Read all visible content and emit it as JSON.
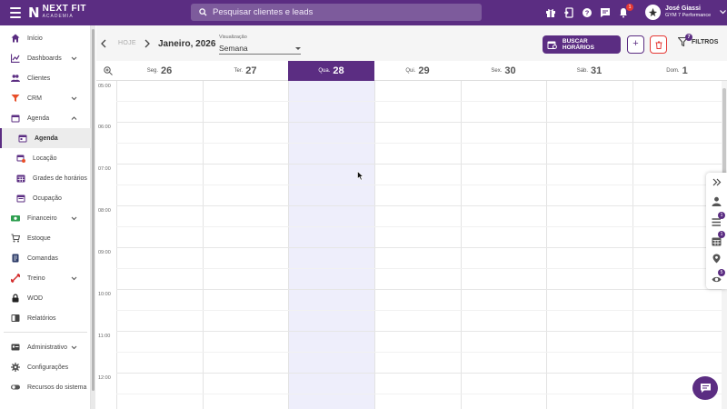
{
  "topbar": {
    "logo_name": "NEXT FIT",
    "logo_sub": "ACADEMIA",
    "search_placeholder": "Pesquisar clientes e leads",
    "notification_count": "1",
    "user_name": "José Giassi",
    "user_gym": "GYM 7 Performance",
    "brand_color": "#5b2d82",
    "icons": [
      "gift-icon",
      "mobile-icon",
      "help-icon",
      "chat-icon",
      "bell-icon"
    ]
  },
  "sidebar": {
    "items": [
      {
        "label": "Início",
        "icon": "home-icon"
      },
      {
        "label": "Dashboards",
        "icon": "chart-icon"
      },
      {
        "label": "Clientes",
        "icon": "users-icon"
      },
      {
        "label": "CRM",
        "icon": "crm-icon"
      },
      {
        "label": "Agenda",
        "icon": "calendar-icon"
      },
      {
        "label": "Agenda",
        "icon": "calendar-day-icon"
      },
      {
        "label": "Locação",
        "icon": "calendar-location-icon"
      },
      {
        "label": "Grades de horários",
        "icon": "calendar-grid-icon"
      },
      {
        "label": "Ocupação",
        "icon": "calendar-occupancy-icon"
      },
      {
        "label": "Financeiro",
        "icon": "money-icon"
      },
      {
        "label": "Estoque",
        "icon": "cart-icon"
      },
      {
        "label": "Comandas",
        "icon": "ticket-icon"
      },
      {
        "label": "Treino",
        "icon": "dumbbell-icon"
      },
      {
        "label": "WOD",
        "icon": "lock-icon"
      },
      {
        "label": "Relatórios",
        "icon": "report-icon"
      },
      {
        "label": "Administrativo",
        "icon": "admin-icon"
      },
      {
        "label": "Configurações",
        "icon": "gear-icon"
      },
      {
        "label": "Recursos do sistema",
        "icon": "toggle-icon"
      }
    ]
  },
  "toolbar": {
    "today_label": "HOJE",
    "month_label": "Janeiro, 2026",
    "view_label": "Visualização",
    "view_value": "Semana",
    "search_times_label": "BUSCAR HORÁRIOS",
    "add_label": "+",
    "filters_label": "FILTROS",
    "filters_count": "7"
  },
  "days": [
    {
      "name": "Seg.",
      "num": "26"
    },
    {
      "name": "Ter.",
      "num": "27"
    },
    {
      "name": "Qua.",
      "num": "28",
      "today": true
    },
    {
      "name": "Qui.",
      "num": "29"
    },
    {
      "name": "Sex.",
      "num": "30"
    },
    {
      "name": "Sáb.",
      "num": "31"
    },
    {
      "name": "Dom.",
      "num": "1"
    }
  ],
  "hours": [
    "05:00",
    "06:00",
    "07:00",
    "08:00",
    "09:00",
    "10:00",
    "11:00",
    "12:00"
  ],
  "right_panel": {
    "icons": [
      "double-chevron-right-icon",
      "person-icon",
      "list-icon",
      "calendar-icon",
      "pin-icon",
      "eye-icon"
    ],
    "badges": [
      "1",
      "1",
      "5"
    ]
  }
}
